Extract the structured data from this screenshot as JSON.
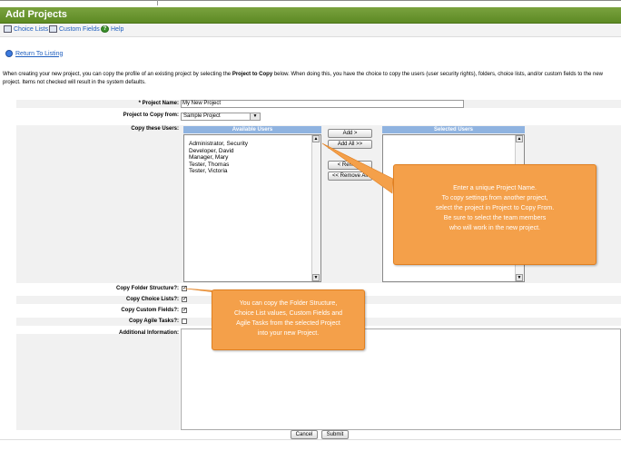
{
  "window": {
    "title": "Add Projects"
  },
  "toolbar": {
    "choice_lists": "Choice Lists",
    "custom_fields": "Custom Fields",
    "help": "Help"
  },
  "return_link": "Return To Listing",
  "description": {
    "part1": "When creating your new project, you can copy the profile of an existing project by selecting the ",
    "bold": "Project to Copy",
    "part2": " below. When doing this, you have the choice to copy the users (user security rights), folders, choice lists, and/or custom fields to the new project. Items not checked will result in the system defaults."
  },
  "form": {
    "project_name_label": "* Project Name:",
    "project_name_value": "My New Project",
    "copy_from_label": "Project to Copy from:",
    "copy_from_value": "Sample Project",
    "copy_users_label": "Copy these Users:",
    "available_users_header": "Available Users",
    "selected_users_header": "Selected Users",
    "available_users": [
      "Administrator, Security",
      "Developer, David",
      "Manager, Mary",
      "Tester, Thomas",
      "Tester, Victoria"
    ],
    "add_label": "Add >",
    "add_all_label": "Add All >>",
    "remove_label": "< Remove",
    "remove_all_label": "<< Remove All",
    "copy_folder_label": "Copy Folder Structure?:",
    "copy_choice_label": "Copy Choice Lists?:",
    "copy_custom_label": "Copy Custom Fields?:",
    "copy_agile_label": "Copy Agile Tasks?:",
    "additional_info_label": "Additional Information:",
    "copy_folder_checked": true,
    "copy_choice_checked": true,
    "copy_custom_checked": true,
    "copy_agile_checked": false,
    "cancel_label": "Cancel",
    "submit_label": "Submit"
  },
  "callouts": {
    "right": [
      "Enter a unique Project Name.",
      "To copy settings from another project,",
      "select the project in Project to Copy From.",
      "Be sure to select the team members",
      "who will work in the new project."
    ],
    "left": [
      "You can copy the Folder Structure,",
      "Choice List values, Custom Fields and",
      "Agile Tasks from the selected Project",
      "into your new Project."
    ]
  },
  "colors": {
    "title_bar": "#6a9630",
    "callout": "#f4a04a",
    "list_header": "#8fb3e0",
    "link": "#1f5fbf"
  }
}
